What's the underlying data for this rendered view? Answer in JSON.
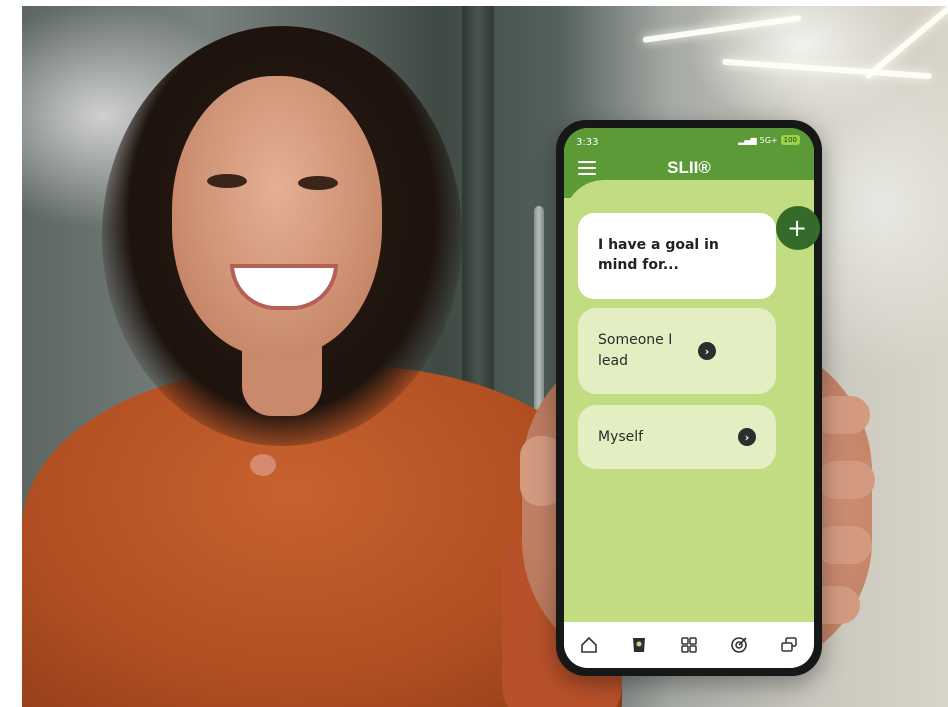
{
  "status_bar": {
    "time": "3:33",
    "signal": "5G+",
    "battery": "100"
  },
  "app": {
    "logo": "SLII®"
  },
  "prompt": {
    "text": "I have a goal in mind for..."
  },
  "options": [
    {
      "label": "Someone I lead"
    },
    {
      "label": "Myself"
    }
  ],
  "add_button": {
    "symbol": "+"
  },
  "nav": [
    {
      "icon": "home-icon"
    },
    {
      "icon": "book-icon"
    },
    {
      "icon": "grid-icon"
    },
    {
      "icon": "target-icon"
    },
    {
      "icon": "chat-icon"
    }
  ],
  "colors": {
    "header_green": "#5c9a38",
    "screen_green": "#c2dc82",
    "card_light": "#e3efc3",
    "accent_dark_green": "#356b2a"
  }
}
